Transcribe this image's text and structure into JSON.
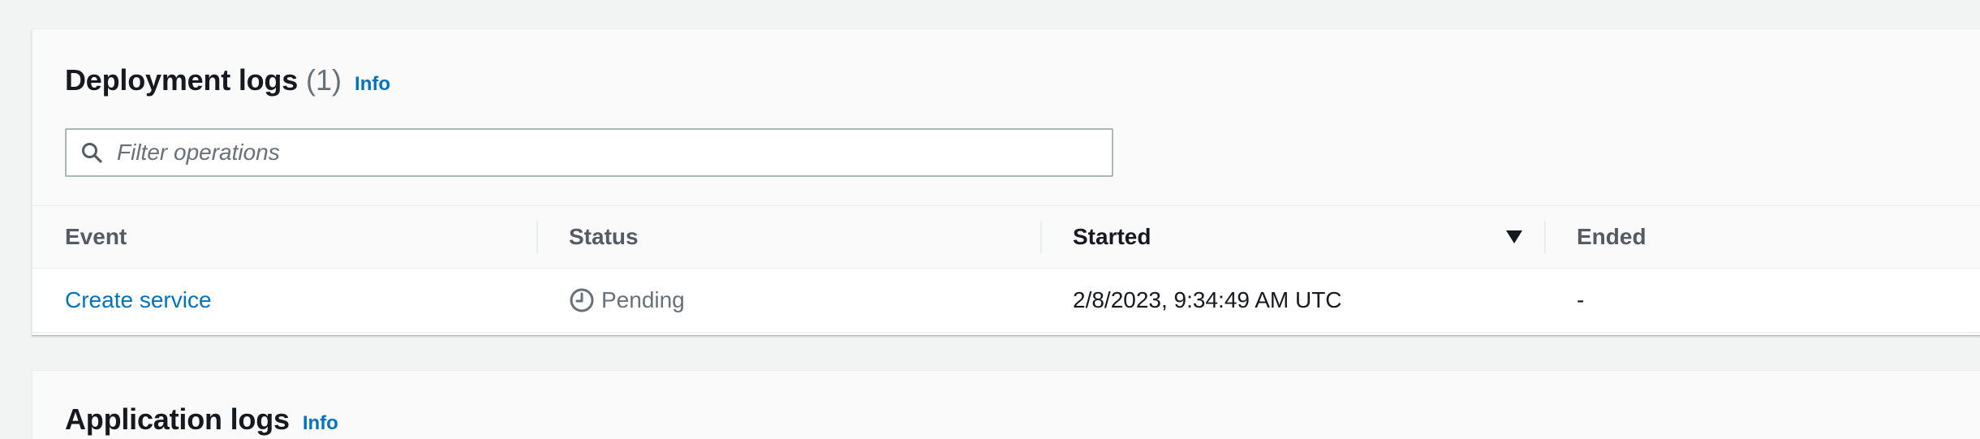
{
  "deployment_logs": {
    "title": "Deployment logs",
    "count": "(1)",
    "info": "Info",
    "filter": {
      "placeholder": "Filter operations",
      "value": "",
      "icon": "search-icon"
    },
    "columns": {
      "event": "Event",
      "status": "Status",
      "started": "Started",
      "ended": "Ended"
    },
    "sort": {
      "column": "started",
      "direction": "descending",
      "icon": "caret-down-icon"
    },
    "rows": [
      {
        "event": "Create service",
        "status": "Pending",
        "status_icon": "clock-icon",
        "started": "2/8/2023, 9:34:49 AM UTC",
        "ended": "-"
      }
    ]
  },
  "application_logs": {
    "title": "Application logs",
    "info": "Info"
  },
  "colors": {
    "link": "#0073bb",
    "pending": "#687078",
    "background": "#f2f3f3"
  }
}
